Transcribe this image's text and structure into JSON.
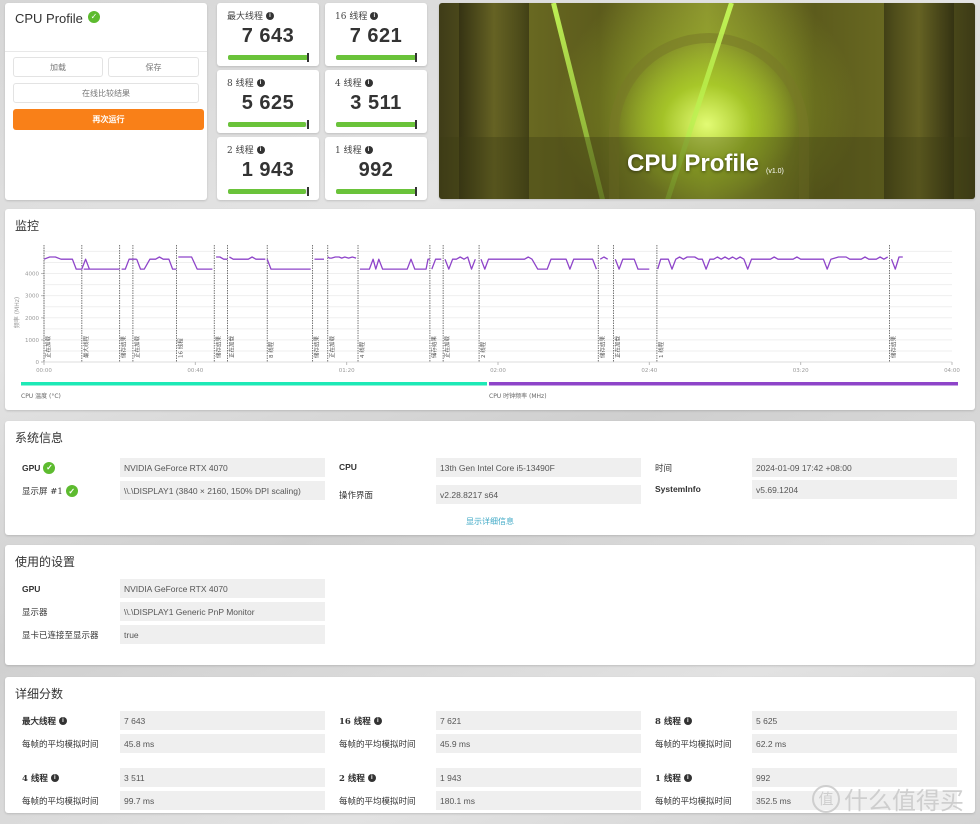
{
  "profile_card": {
    "title": "CPU Profile",
    "status_icon": "check-circle-icon",
    "buttons": {
      "load": "加载",
      "save": "保存",
      "compare_online": "在线比较结果",
      "run_again": "再次运行"
    },
    "colors": {
      "accent": "#f98018",
      "success": "#5dbb2f"
    }
  },
  "score_tiles": [
    {
      "label": "最大线程",
      "value": "7 643",
      "progress": 1.0
    },
    {
      "label": "16 线程",
      "value": "7 621",
      "progress": 1.0
    },
    {
      "label": "8 线程",
      "value": "5 625",
      "progress": 0.97
    },
    {
      "label": "4 线程",
      "value": "3 511",
      "progress": 1.0
    },
    {
      "label": "2 线程",
      "value": "1 943",
      "progress": 0.97
    },
    {
      "label": "1 线程",
      "value": "992",
      "progress": 1.0
    }
  ],
  "hero": {
    "title": "CPU Profile",
    "version": "(v1.0)"
  },
  "monitor": {
    "title": "监控",
    "legend": [
      {
        "label": "CPU 温度 (°C)",
        "color": "#1de9b6"
      },
      {
        "label": "CPU 时钟频率 (MHz)",
        "color": "#8e44c9"
      }
    ]
  },
  "chart_data": {
    "type": "line",
    "title": "监控",
    "xlabel": "",
    "ylabel": "频率 (MHz)",
    "xlim": [
      0,
      240
    ],
    "ylim": [
      0,
      5200
    ],
    "x_ticks": [
      {
        "t": 0,
        "label": "00:00"
      },
      {
        "t": 40,
        "label": "00:40"
      },
      {
        "t": 80,
        "label": "01:20"
      },
      {
        "t": 120,
        "label": "02:00"
      },
      {
        "t": 160,
        "label": "02:40"
      },
      {
        "t": 200,
        "label": "03:20"
      },
      {
        "t": 240,
        "label": "04:00"
      }
    ],
    "y_ticks": [
      0,
      1000,
      2000,
      3000,
      4000
    ],
    "grid": true,
    "legend_position": "bottom",
    "markers": [
      {
        "t": 0,
        "label": "正在加载"
      },
      {
        "t": 10,
        "label": "最大线程"
      },
      {
        "t": 20,
        "label": "储存结果"
      },
      {
        "t": 23.5,
        "label": "正在加载"
      },
      {
        "t": 35,
        "label": "16 线程"
      },
      {
        "t": 45,
        "label": "储存结果"
      },
      {
        "t": 48.5,
        "label": "正在加载"
      },
      {
        "t": 59,
        "label": "8 线程"
      },
      {
        "t": 71,
        "label": "储存结果"
      },
      {
        "t": 75,
        "label": "正在加载"
      },
      {
        "t": 83,
        "label": "4 线程"
      },
      {
        "t": 102,
        "label": "储存结果"
      },
      {
        "t": 105.5,
        "label": "正在加载"
      },
      {
        "t": 115,
        "label": "2 线程"
      },
      {
        "t": 146.5,
        "label": "储存结果"
      },
      {
        "t": 150.5,
        "label": "正在加载"
      },
      {
        "t": 162,
        "label": "1 线程"
      },
      {
        "t": 223.5,
        "label": "储存结果"
      }
    ],
    "series": [
      {
        "name": "CPU 时钟频率 (MHz)",
        "color": "#8e44c9",
        "segments": [
          [
            [
              0,
              4650
            ],
            [
              1.5,
              4750
            ],
            [
              3,
              4750
            ],
            [
              4.5,
              4650
            ],
            [
              7.5,
              4650
            ],
            [
              8.5,
              4200
            ],
            [
              10,
              4200
            ],
            [
              11,
              4650
            ],
            [
              12,
              4200
            ]
          ],
          [
            [
              10.5,
              4200
            ],
            [
              20,
              4200
            ]
          ],
          [
            [
              20.5,
              4200
            ],
            [
              21.5,
              4200
            ],
            [
              22.5,
              4650
            ],
            [
              24.5,
              4650
            ]
          ],
          [
            [
              24.5,
              4650
            ],
            [
              25.5,
              4200
            ],
            [
              26.5,
              4200
            ],
            [
              28,
              4650
            ],
            [
              29.5,
              4650
            ],
            [
              30.5,
              4750
            ],
            [
              31.5,
              4650
            ],
            [
              33,
              4650
            ],
            [
              34,
              4200
            ],
            [
              35,
              4200
            ]
          ],
          [
            [
              35.5,
              4750
            ],
            [
              39,
              4750
            ],
            [
              40.5,
              4200
            ],
            [
              44.5,
              4200
            ]
          ],
          [
            [
              45.5,
              4750
            ],
            [
              46.5,
              4750
            ],
            [
              47.5,
              4650
            ],
            [
              48.5,
              4650
            ]
          ],
          [
            [
              49,
              4750
            ],
            [
              50,
              4650
            ],
            [
              54,
              4650
            ],
            [
              55,
              4750
            ],
            [
              56,
              4650
            ],
            [
              58.5,
              4650
            ]
          ],
          [
            [
              59,
              4650
            ],
            [
              60,
              4200
            ],
            [
              70.5,
              4200
            ]
          ],
          [
            [
              71.5,
              4650
            ],
            [
              74,
              4650
            ]
          ],
          [
            [
              75,
              4750
            ],
            [
              75.5,
              4700
            ],
            [
              76,
              4700
            ],
            [
              77,
              4750
            ],
            [
              78,
              4750
            ],
            [
              78.7,
              4700
            ],
            [
              79.5,
              4750
            ],
            [
              80.5,
              4700
            ],
            [
              81.5,
              4750
            ],
            [
              82.5,
              4700
            ]
          ],
          [
            [
              83.5,
              4200
            ],
            [
              86,
              4200
            ],
            [
              87,
              4650
            ],
            [
              87.7,
              4200
            ],
            [
              88.5,
              4650
            ],
            [
              89.5,
              4200
            ],
            [
              96,
              4200
            ],
            [
              97,
              4650
            ],
            [
              98,
              4200
            ],
            [
              101,
              4200
            ],
            [
              101.5,
              4650
            ],
            [
              102,
              4650
            ]
          ],
          [
            [
              102.5,
              4200
            ],
            [
              103.5,
              4650
            ],
            [
              105,
              4650
            ]
          ],
          [
            [
              106,
              4650
            ],
            [
              107,
              4200
            ],
            [
              108,
              4650
            ],
            [
              109,
              4650
            ],
            [
              110,
              4750
            ],
            [
              111,
              4650
            ],
            [
              112,
              4750
            ],
            [
              113,
              4200
            ],
            [
              114,
              4650
            ]
          ],
          [
            [
              115.5,
              4650
            ],
            [
              116.5,
              4200
            ],
            [
              117.5,
              4650
            ],
            [
              127,
              4650
            ],
            [
              128,
              4750
            ],
            [
              129,
              4650
            ],
            [
              130.5,
              4200
            ],
            [
              133,
              4200
            ],
            [
              134,
              4650
            ],
            [
              138,
              4650
            ],
            [
              139,
              4200
            ],
            [
              140,
              4650
            ],
            [
              145,
              4650
            ],
            [
              146,
              4200
            ]
          ],
          [
            [
              147,
              4650
            ],
            [
              148,
              4750
            ],
            [
              149,
              4650
            ]
          ],
          [
            [
              151,
              4650
            ],
            [
              152,
              4200
            ],
            [
              153,
              4650
            ],
            [
              156,
              4650
            ],
            [
              157,
              4200
            ],
            [
              158,
              4200
            ],
            [
              160,
              4200
            ]
          ],
          [
            [
              162.2,
              4200
            ],
            [
              163,
              4650
            ],
            [
              165,
              4650
            ],
            [
              166,
              4200
            ],
            [
              167,
              4650
            ],
            [
              168,
              4750
            ],
            [
              169,
              4650
            ],
            [
              170,
              4750
            ],
            [
              172,
              4750
            ],
            [
              173,
              4650
            ],
            [
              174,
              4650
            ],
            [
              175,
              4200
            ],
            [
              176,
              4650
            ],
            [
              177,
              4650
            ],
            [
              178,
              4750
            ],
            [
              179,
              4650
            ],
            [
              180,
              4750
            ],
            [
              181,
              4650
            ],
            [
              182,
              4750
            ],
            [
              183,
              4650
            ],
            [
              184,
              4750
            ],
            [
              185,
              4650
            ],
            [
              186,
              4200
            ],
            [
              187,
              4650
            ],
            [
              192,
              4650
            ],
            [
              193,
              4750
            ],
            [
              194,
              4650
            ],
            [
              198,
              4650
            ],
            [
              199,
              4750
            ],
            [
              200,
              4650
            ],
            [
              206,
              4650
            ],
            [
              207,
              4200
            ],
            [
              208,
              4650
            ],
            [
              210,
              4750
            ],
            [
              212,
              4750
            ],
            [
              213,
              4650
            ],
            [
              216,
              4650
            ],
            [
              217,
              4750
            ],
            [
              218,
              4650
            ],
            [
              220,
              4650
            ],
            [
              221,
              4750
            ],
            [
              222,
              4650
            ],
            [
              223,
              4750
            ]
          ],
          [
            [
              224,
              4650
            ],
            [
              225,
              4200
            ],
            [
              226,
              4750
            ],
            [
              227,
              4750
            ]
          ]
        ]
      }
    ]
  },
  "system_info": {
    "title": "系统信息",
    "rows": [
      {
        "label": "GPU",
        "value": "NVIDIA GeForce RTX 4070",
        "verified": true
      },
      {
        "label": "显示屏 #1",
        "value": "\\\\.\\DISPLAY1 (3840 × 2160, 150% DPI scaling)",
        "verified": true
      },
      {
        "label": "CPU",
        "value": "13th Gen Intel Core i5-13490F"
      },
      {
        "label": "操作界面",
        "value": "v2.28.8217 s64"
      },
      {
        "label": "时间",
        "value": "2024-01-09 17:42 +08:00"
      },
      {
        "label": "SystemInfo",
        "value": "v5.69.1204"
      }
    ],
    "show_details_link": "显示详细信息"
  },
  "settings_used": {
    "title": "使用的设置",
    "rows": [
      {
        "label": "GPU",
        "value": "NVIDIA GeForce RTX 4070"
      },
      {
        "label": "显示器",
        "value": "\\\\.\\DISPLAY1 Generic PnP Monitor"
      },
      {
        "label": "显卡已连接至显示器",
        "value": "true"
      }
    ]
  },
  "detailed_scores": {
    "title": "详细分数",
    "frame_time_label": "每帧的平均模拟时间",
    "groups": [
      {
        "label": "最大线程",
        "score": "7 643",
        "frame_time": "45.8 ms"
      },
      {
        "label": "16 线程",
        "score": "7 621",
        "frame_time": "45.9 ms"
      },
      {
        "label": "8 线程",
        "score": "5 625",
        "frame_time": "62.2 ms"
      },
      {
        "label": "4 线程",
        "score": "3 511",
        "frame_time": "99.7 ms"
      },
      {
        "label": "2 线程",
        "score": "1 943",
        "frame_time": "180.1 ms"
      },
      {
        "label": "1 线程",
        "score": "992",
        "frame_time": "352.5 ms"
      }
    ]
  },
  "watermark": {
    "badge": "值",
    "text": "什么值得买"
  }
}
